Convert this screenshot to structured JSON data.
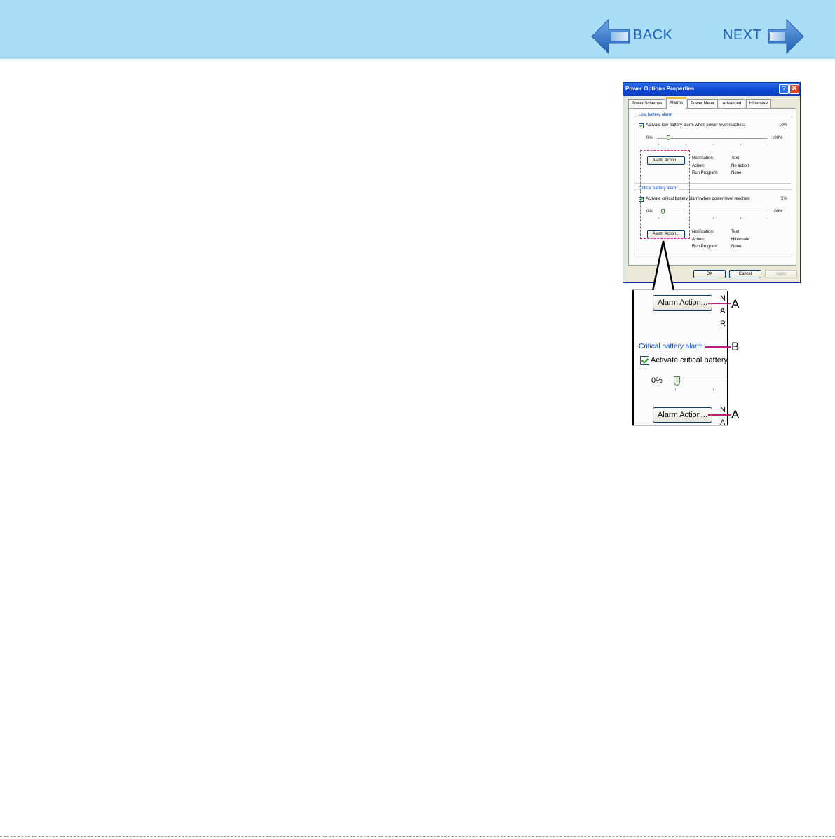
{
  "header": {
    "back_label": "BACK",
    "next_label": "NEXT"
  },
  "dialog": {
    "title": "Power Options Properties",
    "help_glyph": "?",
    "close_glyph": "✕",
    "tabs": [
      "Power Schemes",
      "Alarms",
      "Power Meter",
      "Advanced",
      "Hibernate"
    ],
    "active_tab": "Alarms",
    "low": {
      "group_label": "Low battery alarm",
      "checkbox_label": "Activate low battery alarm when power level reaches:",
      "level_value": "10%",
      "slider_fraction": 0.1,
      "min_label": "0%",
      "max_label": "100%",
      "button_label": "Alarm Action...",
      "info": [
        {
          "key": "Notification:",
          "value": "Text"
        },
        {
          "key": "Action:",
          "value": "No action"
        },
        {
          "key": "Run Program:",
          "value": "None"
        }
      ]
    },
    "critical": {
      "group_label": "Critical battery alarm",
      "checkbox_label": "Activate critical battery alarm when power level reaches:",
      "level_value": "5%",
      "slider_fraction": 0.05,
      "min_label": "0%",
      "max_label": "100%",
      "button_label": "Alarm Action...",
      "info": [
        {
          "key": "Notification:",
          "value": "Text"
        },
        {
          "key": "Action:",
          "value": "Hibernate"
        },
        {
          "key": "Run Program:",
          "value": "None"
        }
      ]
    },
    "ok_label": "OK",
    "cancel_label": "Cancel",
    "apply_label": "Apply"
  },
  "callout": {
    "button_label": "Alarm Action...",
    "group_label": "Critical battery alarm",
    "checkbox_label": "Activate critical battery",
    "min_label": "0%",
    "side_letters": [
      "N",
      "A",
      "R",
      "N",
      "A"
    ]
  },
  "markers": {
    "a": "A",
    "b": "B"
  },
  "colors": {
    "header_bg": "#a9dcf5",
    "nav_text": "#2060b8",
    "highlight": "#e0208c"
  }
}
